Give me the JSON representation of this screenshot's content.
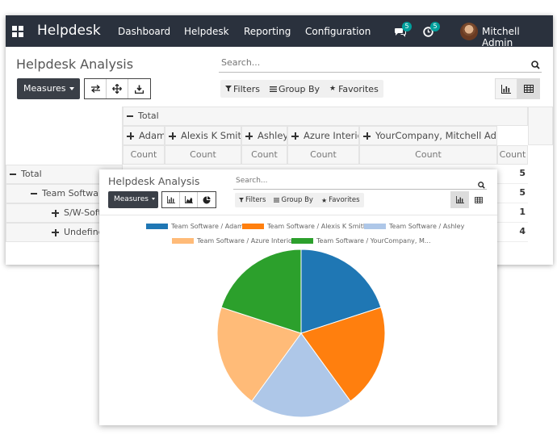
{
  "navbar": {
    "brand": "Helpdesk",
    "menu": [
      "Dashboard",
      "Helpdesk",
      "Reporting",
      "Configuration"
    ],
    "messages_badge": "5",
    "activities_badge": "5",
    "user_name": "Mitchell Admin"
  },
  "back": {
    "title": "Helpdesk Analysis",
    "search_placeholder": "Search...",
    "measures_label": "Measures",
    "filters_label": "Filters",
    "groupby_label": "Group By",
    "favorites_label": "Favorites"
  },
  "pivot": {
    "col_total": "Total",
    "columns": [
      "Adam",
      "Alexis K Smith",
      "Ashley",
      "Azure Interior",
      "YourCompany, Mitchell Admin"
    ],
    "measure": "Count",
    "rows": [
      {
        "label": "Total",
        "value": "5"
      },
      {
        "label": "Team Software",
        "value": "5"
      },
      {
        "label": "S/W-Soft",
        "value": "1"
      },
      {
        "label": "Undefine",
        "value": "4"
      }
    ]
  },
  "front": {
    "title": "Helpdesk Analysis",
    "search_placeholder": "Search...",
    "measures_label": "Measures",
    "filters_label": "Filters",
    "groupby_label": "Group By",
    "favorites_label": "Favorites"
  },
  "chart_data": {
    "type": "pie",
    "series": [
      {
        "name": "Team Software / Adam",
        "value": 1,
        "color": "#1f77b4"
      },
      {
        "name": "Team Software / Alexis K Smith",
        "value": 1,
        "color": "#ff7f0e"
      },
      {
        "name": "Team Software / Ashley",
        "value": 1,
        "color": "#aec7e8"
      },
      {
        "name": "Team Software / Azure Interior",
        "value": 1,
        "color": "#ffbb78"
      },
      {
        "name": "Team Software / YourCompany, M...",
        "value": 1,
        "color": "#2ca02c"
      }
    ],
    "legend_position": "top"
  }
}
